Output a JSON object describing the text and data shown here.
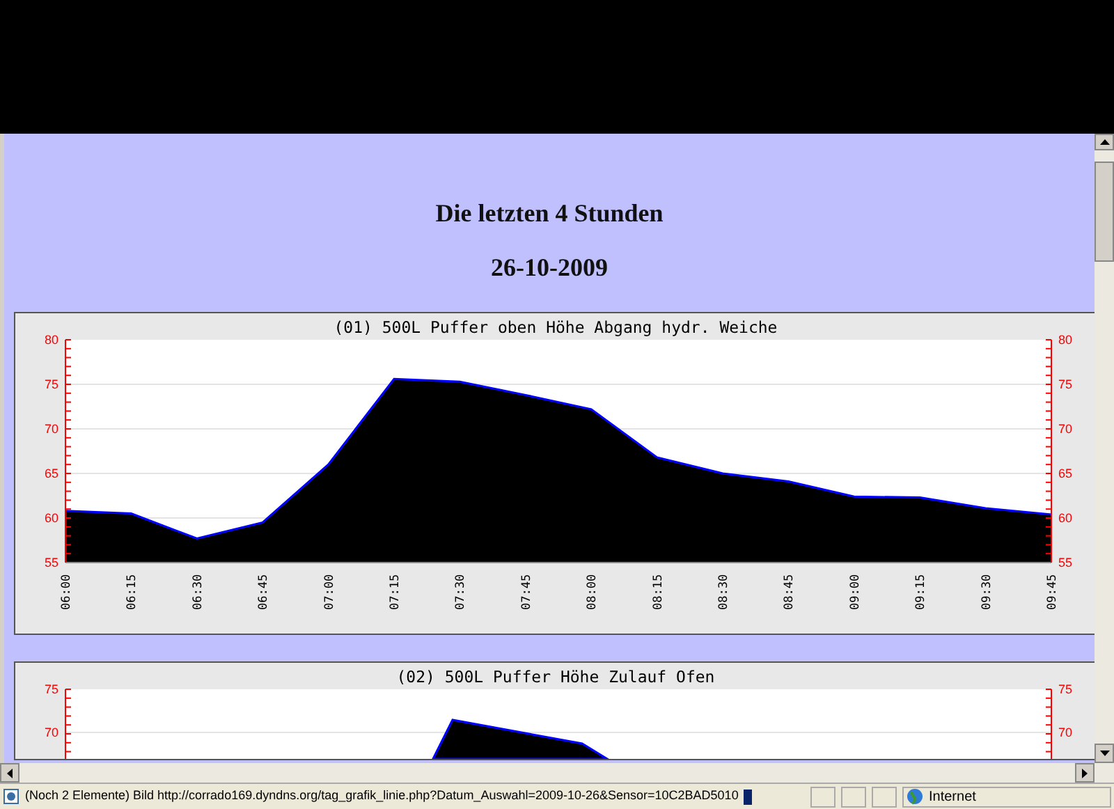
{
  "page": {
    "heading": "Die letzten 4 Stunden",
    "date": "26-10-2009"
  },
  "charts": [
    {
      "title": "(01) 500L Puffer oben Höhe Abgang hydr. Weiche",
      "chart_data": {
        "type": "area",
        "categories": [
          "06:00",
          "06:15",
          "06:30",
          "06:45",
          "07:00",
          "07:15",
          "07:30",
          "07:45",
          "08:00",
          "08:15",
          "08:30",
          "08:45",
          "09:00",
          "09:15",
          "09:30",
          "09:45"
        ],
        "series": [
          {
            "color": "#0000ff",
            "values": [
              60.8,
              60.5,
              57.7,
              59.5,
              66.0,
              75.6,
              75.3,
              73.8,
              72.2,
              66.8,
              65.0,
              64.1,
              62.4,
              62.3,
              61.1,
              60.4
            ]
          }
        ],
        "ylim": [
          55,
          80
        ],
        "yticks": [
          55,
          60,
          65,
          70,
          75,
          80
        ],
        "grid": true
      },
      "right_tick_labels": [
        "80",
        "75",
        "70",
        "65",
        "60",
        "55"
      ]
    },
    {
      "title": "(02) 500L Puffer Höhe Zulauf Ofen",
      "left_tick_labels": [
        "75",
        "70"
      ],
      "right_tick_labels": [
        "75",
        "70"
      ]
    }
  ],
  "status_bar": {
    "text": "(Noch 2 Elemente) Bild http://corrado169.dyndns.org/tag_grafik_linie.php?Datum_Auswahl=2009-10-26&Sensor=10C2BAD5010",
    "zone": "Internet"
  }
}
